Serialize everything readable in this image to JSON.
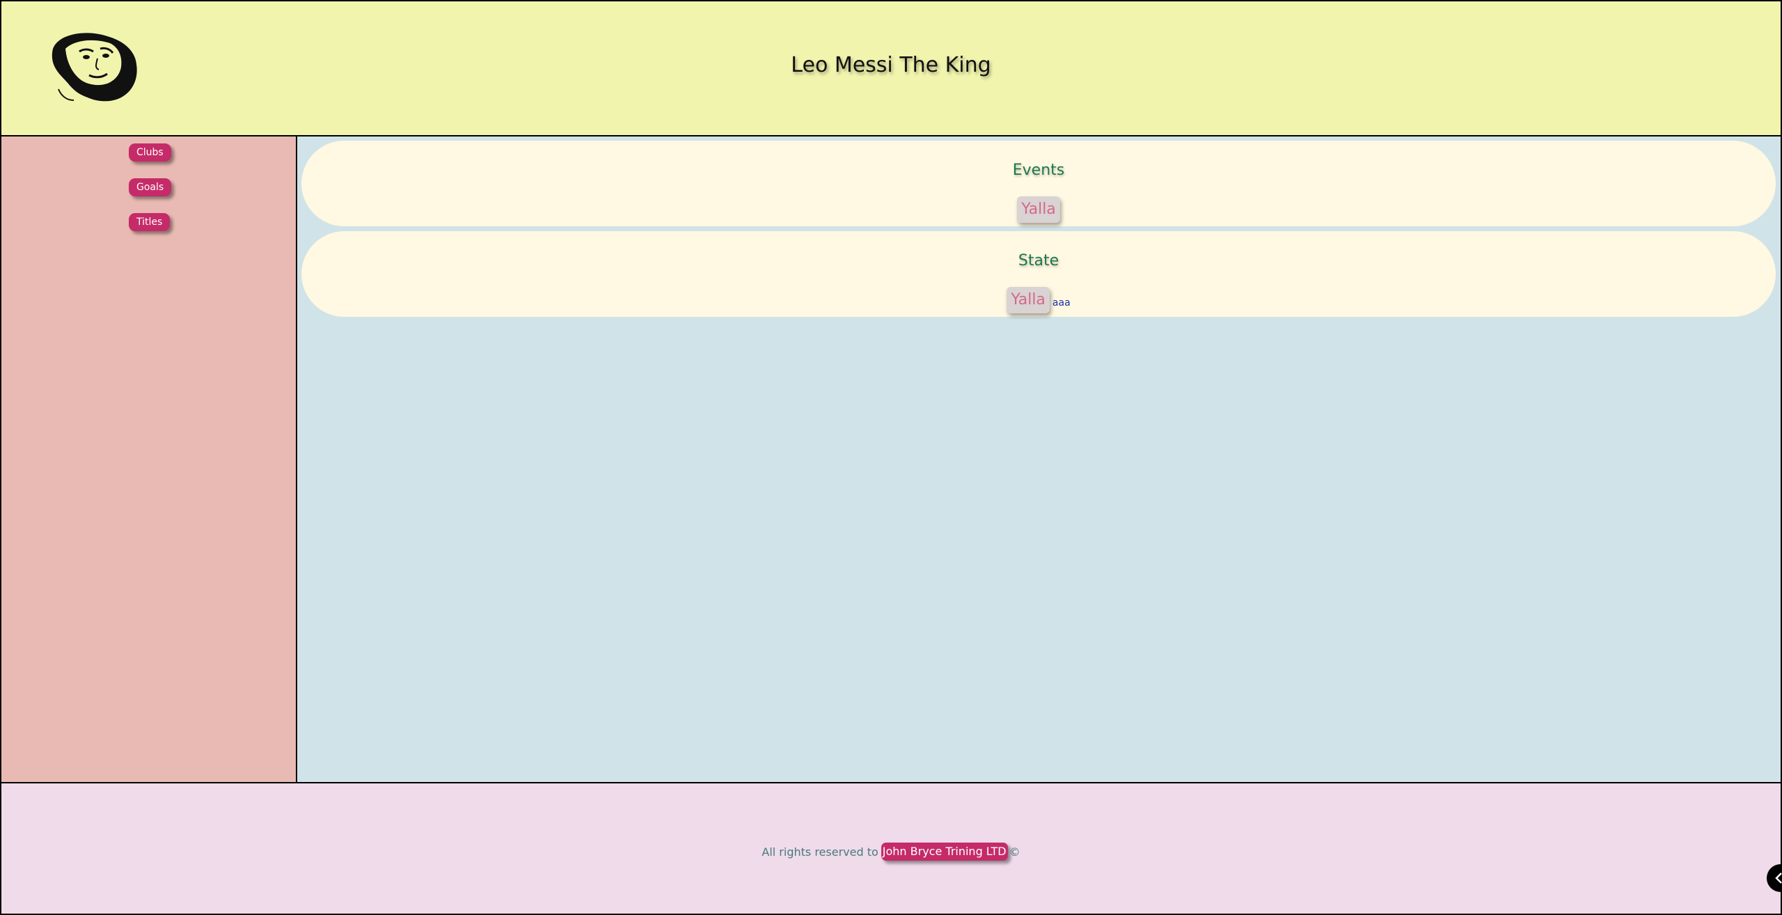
{
  "header": {
    "title": "Leo Messi The King",
    "logo_icon": "messi-portrait-icon"
  },
  "sidebar": {
    "items": [
      {
        "label": "Clubs"
      },
      {
        "label": "Goals"
      },
      {
        "label": "Titles"
      }
    ]
  },
  "main": {
    "cards": [
      {
        "title": "Events",
        "button_label": "Yalla",
        "link_label": ""
      },
      {
        "title": "State",
        "button_label": "Yalla",
        "link_label": "aaa"
      }
    ]
  },
  "footer": {
    "prefix": "All rights reserved to",
    "company": "John Bryce Trining LTD",
    "suffix": "©"
  },
  "colors": {
    "header_bg": "#f1f4ad",
    "sidebar_bg": "#e9bab3",
    "main_bg": "#d0e3e8",
    "card_bg": "#fff8e2",
    "footer_bg": "#efdbea",
    "accent": "#c52b68",
    "card_title": "#1c7a4c"
  },
  "corner_button_icon": "chevron-left-icon"
}
